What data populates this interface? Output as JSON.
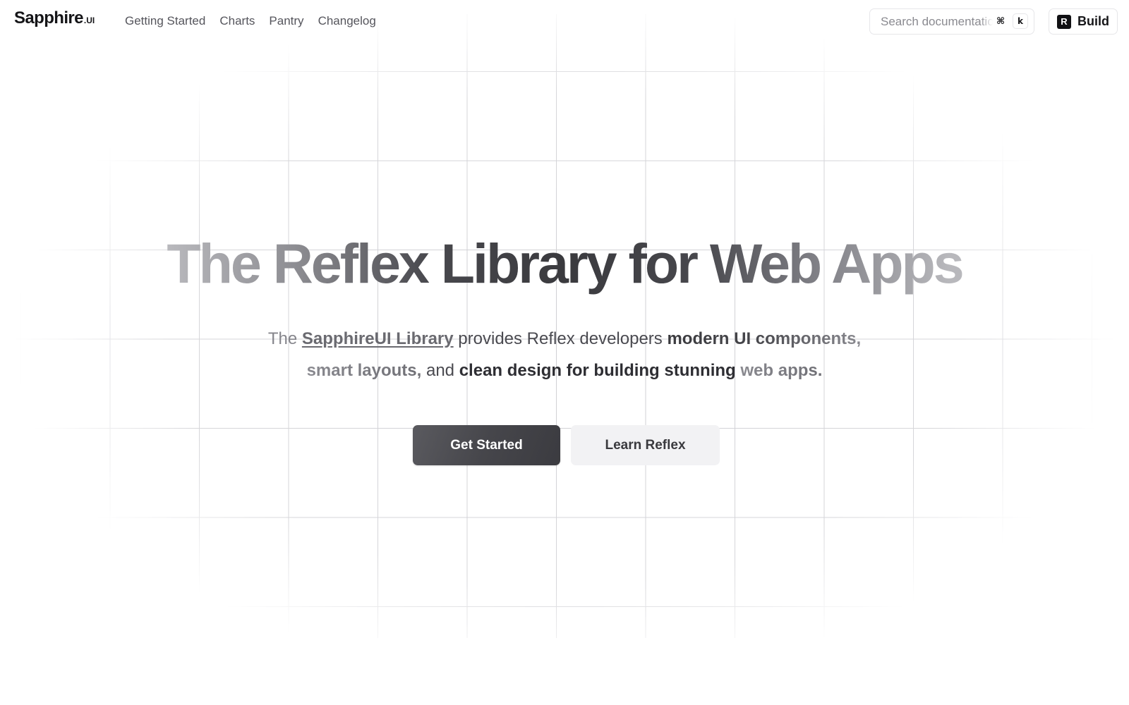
{
  "brand": {
    "name": "Sapphire",
    "suffix": ".UI"
  },
  "nav": {
    "items": [
      {
        "label": "Getting Started"
      },
      {
        "label": "Charts"
      },
      {
        "label": "Pantry"
      },
      {
        "label": "Changelog"
      }
    ]
  },
  "search": {
    "placeholder": "Search documentation",
    "shortcut_modifier": "⌘",
    "shortcut_key": "k"
  },
  "build_button": {
    "icon_letter": "R",
    "label": "Build"
  },
  "hero": {
    "title": "The Reflex Library for Web Apps",
    "subtitle": {
      "prefix": "The ",
      "link": "SapphireUI Library",
      "middle": " provides Reflex developers ",
      "bold_part1": "modern UI components,",
      "bold_part2": "smart layouts,",
      "connector": " and ",
      "bold_part3": "clean design for building stunning",
      "bold_part4": "web apps."
    },
    "primary_button": "Get Started",
    "secondary_button": "Learn Reflex"
  },
  "colors": {
    "background": "#ffffff",
    "primary_button": "#46464b",
    "secondary_button": "#f2f2f4",
    "grid_line": "#d4d4d8"
  }
}
